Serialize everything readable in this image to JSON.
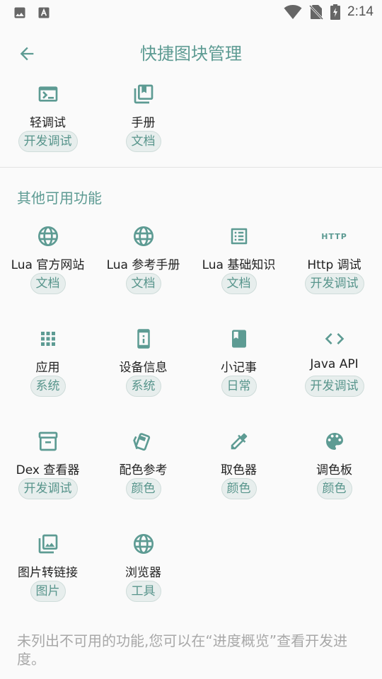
{
  "status_bar": {
    "time": "2:14"
  },
  "app_bar": {
    "title": "快捷图块管理"
  },
  "top_tiles": [
    {
      "label": "轻调试",
      "tag": "开发调试",
      "icon": "terminal-icon"
    },
    {
      "label": "手册",
      "tag": "文档",
      "icon": "library-books-icon"
    }
  ],
  "section": {
    "title": "其他可用功能"
  },
  "tiles": [
    {
      "label": "Lua 官方网站",
      "tag": "文档",
      "icon": "globe-icon"
    },
    {
      "label": "Lua 参考手册",
      "tag": "文档",
      "icon": "globe-icon"
    },
    {
      "label": "Lua 基础知识",
      "tag": "文档",
      "icon": "list-alt-icon"
    },
    {
      "label": "Http 调试",
      "tag": "开发调试",
      "icon": "http-icon",
      "icon_text": "HTTP"
    },
    {
      "label": "应用",
      "tag": "系统",
      "icon": "apps-grid-icon"
    },
    {
      "label": "设备信息",
      "tag": "系统",
      "icon": "device-info-icon"
    },
    {
      "label": "小记事",
      "tag": "日常",
      "icon": "book-icon"
    },
    {
      "label": "Java API",
      "tag": "开发调试",
      "icon": "code-icon"
    },
    {
      "label": "Dex 查看器",
      "tag": "开发调试",
      "icon": "archive-icon"
    },
    {
      "label": "配色参考",
      "tag": "颜色",
      "icon": "swatches-icon"
    },
    {
      "label": "取色器",
      "tag": "颜色",
      "icon": "eyedropper-icon"
    },
    {
      "label": "调色板",
      "tag": "颜色",
      "icon": "palette-icon"
    },
    {
      "label": "图片转链接",
      "tag": "图片",
      "icon": "photo-library-icon"
    },
    {
      "label": "浏览器",
      "tag": "工具",
      "icon": "globe-icon"
    }
  ],
  "footer": {
    "note": "未列出不可用的功能,您可以在“进度概览”查看开发进度。"
  },
  "colors": {
    "accent": "#5d9b93",
    "chip_bg": "#e7eeed",
    "chip_text": "#58958c",
    "icon": "#5d9b93"
  }
}
